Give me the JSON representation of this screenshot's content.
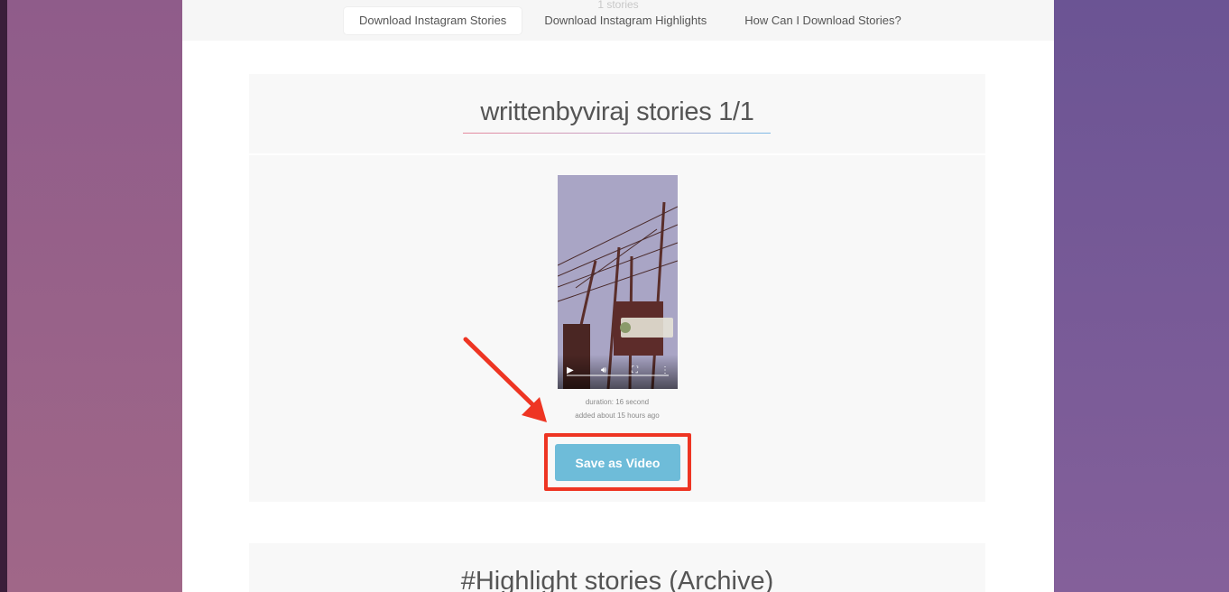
{
  "header": {
    "faded_count": "1 stories",
    "tabs": [
      {
        "label": "Download Instagram Stories",
        "active": true
      },
      {
        "label": "Download Instagram Highlights",
        "active": false
      },
      {
        "label": "How Can I Download Stories?",
        "active": false
      }
    ]
  },
  "story": {
    "title": "writtenbyviraj stories 1/1",
    "duration": "duration: 16 second",
    "added": "added about 15 hours ago",
    "save_label": "Save as Video",
    "progress_fraction": 0
  },
  "highlights": {
    "title": "#Highlight stories (Archive)"
  },
  "colors": {
    "button": "#6ebcd9",
    "annotation": "#ee3523"
  }
}
